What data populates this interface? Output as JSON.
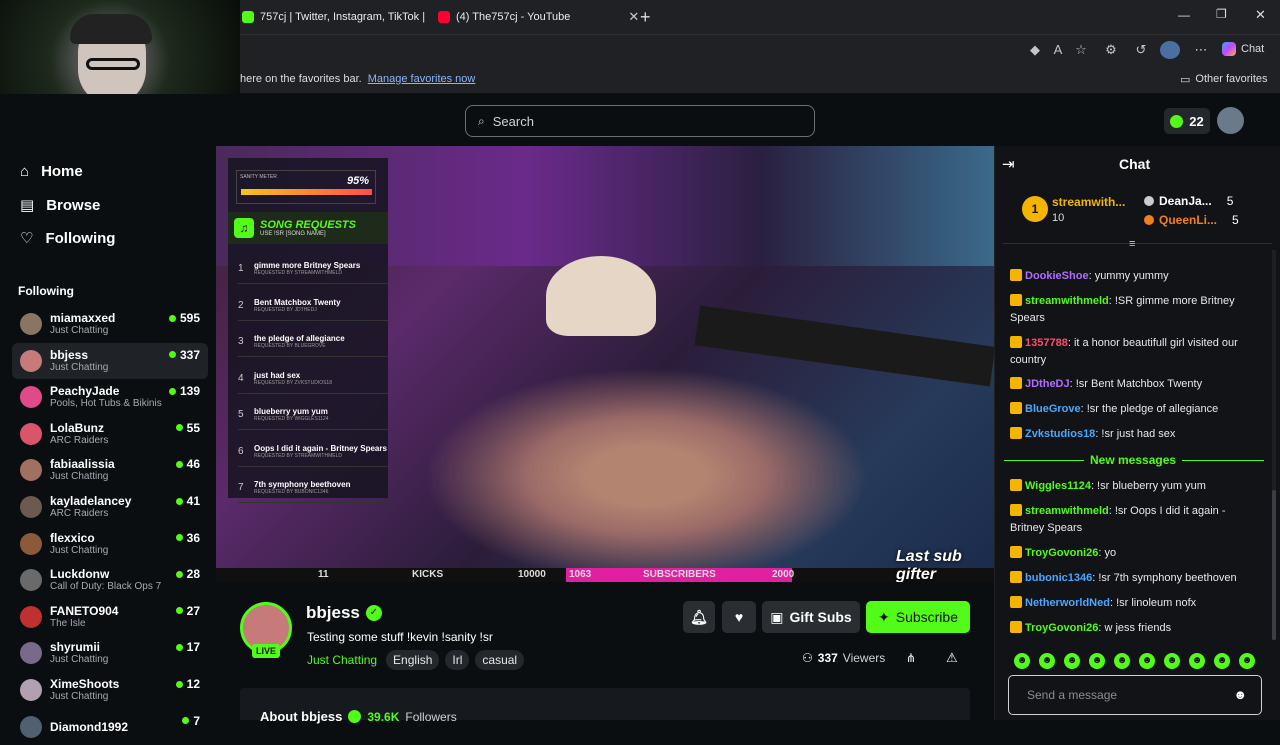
{
  "browser": {
    "tabs": [
      {
        "title": "757cj | Twitter, Instagram, TikTok |"
      },
      {
        "title": "(4) The757cj - YouTube"
      }
    ],
    "favbar_text": "here on the favorites bar.",
    "favbar_link": "Manage favorites now",
    "other_favorites": "Other favorites",
    "chat_button": "Chat"
  },
  "header": {
    "search_placeholder": "Search",
    "points": "22"
  },
  "sidebar": {
    "nav": [
      {
        "label": "Home"
      },
      {
        "label": "Browse"
      },
      {
        "label": "Following"
      }
    ],
    "following_title": "Following",
    "channels": [
      {
        "name": "miamaxxed",
        "category": "Just Chatting",
        "viewers": "595",
        "color": "#8a7565"
      },
      {
        "name": "bbjess",
        "category": "Just Chatting",
        "viewers": "337",
        "color": "#c77a7a"
      },
      {
        "name": "PeachyJade",
        "category": "Pools, Hot Tubs & Bikinis",
        "viewers": "139",
        "color": "#e04a8a"
      },
      {
        "name": "LolaBunz",
        "category": "ARC Raiders",
        "viewers": "55",
        "color": "#d9556b"
      },
      {
        "name": "fabiaalissia",
        "category": "Just Chatting",
        "viewers": "46",
        "color": "#a07060"
      },
      {
        "name": "kayladelancey",
        "category": "ARC Raiders",
        "viewers": "41",
        "color": "#6a5a50"
      },
      {
        "name": "flexxico",
        "category": "Just Chatting",
        "viewers": "36",
        "color": "#8a5a3a"
      },
      {
        "name": "Luckdonw",
        "category": "Call of Duty: Black Ops 7",
        "viewers": "28",
        "color": "#6a6a6a"
      },
      {
        "name": "FANETO904",
        "category": "The Isle",
        "viewers": "27",
        "color": "#c03030"
      },
      {
        "name": "shyrumii",
        "category": "Just Chatting",
        "viewers": "17",
        "color": "#7a6a8a"
      },
      {
        "name": "XimeShoots",
        "category": "Just Chatting",
        "viewers": "12",
        "color": "#b0a0b0"
      },
      {
        "name": "Diamond1992",
        "category": "",
        "viewers": "7",
        "color": "#506070"
      }
    ]
  },
  "video": {
    "sanity_label": "SANITY METER",
    "sanity_value": "95%",
    "song_requests_title": "SONG REQUESTS",
    "song_requests_sub": "USE !SR [SONG NAME]",
    "requests": [
      {
        "n": "1",
        "title": "gimme more Britney Spears",
        "by": "REQUESTED BY STREAMWITHMELD"
      },
      {
        "n": "2",
        "title": "Bent Matchbox Twenty",
        "by": "REQUESTED BY JDTHEDJ"
      },
      {
        "n": "3",
        "title": "the pledge of allegiance",
        "by": "REQUESTED BY BLUEGROVE"
      },
      {
        "n": "4",
        "title": "just had sex",
        "by": "REQUESTED BY ZVKSTUDIOS18"
      },
      {
        "n": "5",
        "title": "blueberry yum yum",
        "by": "REQUESTED BY WIGGLES1124"
      },
      {
        "n": "6",
        "title": "Oops I did it again - Britney Spears",
        "by": "REQUESTED BY STREAMWITHMELD"
      },
      {
        "n": "7",
        "title": "7th symphony beethoven",
        "by": "REQUESTED BY BUBONIC1346"
      }
    ],
    "bar": {
      "kicks_n": "11",
      "kicks": "KICKS",
      "k_goal": "10000",
      "subs_n": "1063",
      "subs": "SUBSCRIBERS",
      "s_goal": "2000"
    },
    "last_sub": "Last sub gifter"
  },
  "stream": {
    "streamer": "bbjess",
    "live": "LIVE",
    "title": "Testing some stuff !kevin !sanity !sr",
    "category": "Just Chatting",
    "tags": [
      "English",
      "Irl",
      "casual"
    ],
    "viewers": "337",
    "viewers_label": "Viewers",
    "gift_subs": "Gift Subs",
    "subscribe": "Subscribe",
    "about": "About bbjess",
    "followers": "39.6K",
    "followers_label": "Followers"
  },
  "chat": {
    "title": "Chat",
    "top_gifter": {
      "rank": "1",
      "name": "streamwith...",
      "count": "10"
    },
    "gifters": [
      {
        "name": "DeanJa...",
        "count": "5"
      },
      {
        "name": "QueenLi...",
        "count": "5"
      }
    ],
    "new_messages": "New messages",
    "messages_before": [
      {
        "user": "DookieShoe",
        "color": "#b16cff",
        "text": ": yummy yummy"
      },
      {
        "user": "streamwithmeld",
        "color": "#53fc18",
        "text": ": !SR gimme more Britney Spears"
      },
      {
        "user": "1357788",
        "color": "#ff4d6d",
        "text": ": it a honor beautifull girl visited our country"
      },
      {
        "user": "JDtheDJ",
        "color": "#b16cff",
        "text": ": !sr Bent Matchbox Twenty"
      },
      {
        "user": "BlueGrove",
        "color": "#4aa8ff",
        "text": ": !sr the pledge of allegiance"
      },
      {
        "user": "Zvkstudios18",
        "color": "#4aa8ff",
        "text": ": !sr just had sex"
      }
    ],
    "messages_after": [
      {
        "user": "Wiggles1124",
        "color": "#53fc18",
        "text": ": !sr blueberry yum yum"
      },
      {
        "user": "streamwithmeld",
        "color": "#53fc18",
        "text": ": !sr Oops I did it again - Britney Spears"
      },
      {
        "user": "TroyGovoni26",
        "color": "#53fc18",
        "text": ": yo"
      },
      {
        "user": "bubonic1346",
        "color": "#4aa8ff",
        "text": ": !sr 7th symphony beethoven"
      },
      {
        "user": "NetherworldNed",
        "color": "#4aa8ff",
        "text": ": !sr linoleum nofx"
      },
      {
        "user": "TroyGovoni26",
        "color": "#53fc18",
        "text": ": w jess friends"
      }
    ],
    "input_placeholder": "Send a message"
  },
  "colors": {
    "accent": "#53fc18",
    "bg": "#0b0e11"
  }
}
